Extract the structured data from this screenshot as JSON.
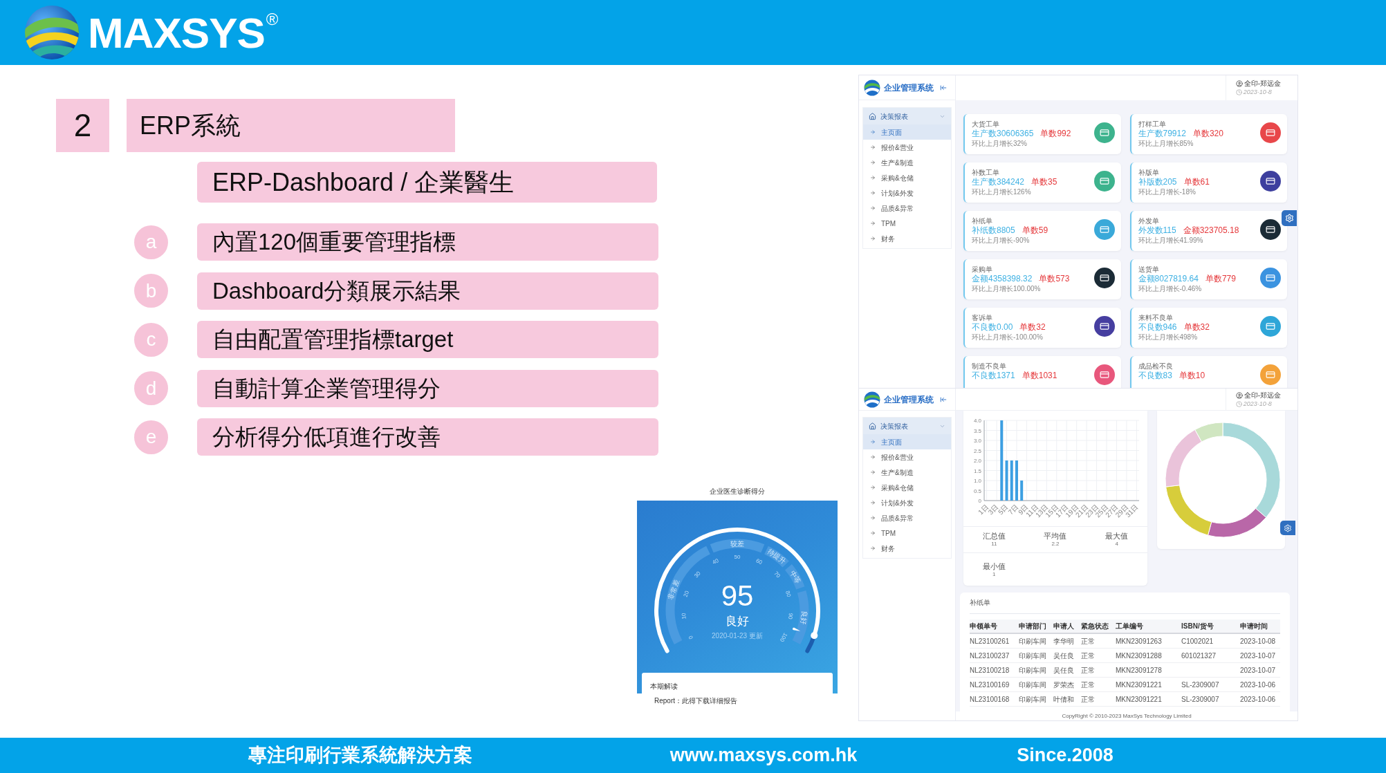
{
  "header": {
    "brand": "MAXSYS",
    "registered": "®"
  },
  "section": {
    "number": "2",
    "title": "ERP系統"
  },
  "subtitle": "ERP-Dashboard / 企業醫生",
  "points": [
    {
      "letter": "a",
      "text": "內置120個重要管理指標"
    },
    {
      "letter": "b",
      "text": "Dashboard分類展示結果"
    },
    {
      "letter": "c",
      "text": "自由配置管理指標target"
    },
    {
      "letter": "d",
      "text": "自動計算企業管理得分"
    },
    {
      "letter": "e",
      "text": "分析得分低項進行改善"
    }
  ],
  "gauge_screenshot": {
    "title": "企业医生诊断得分",
    "bands": [
      "非常差",
      "较差",
      "待提升",
      "中等",
      "良好"
    ],
    "ticks": [
      "0",
      "10",
      "20",
      "30",
      "40",
      "50",
      "60",
      "70",
      "80",
      "90",
      "100"
    ],
    "level": 0.95,
    "score": "95",
    "rating": "良好",
    "updated": "2020-01-23 更新",
    "report": {
      "heading": "本期解读",
      "text": "Report：此得下载详细报告"
    }
  },
  "cards_dashboard": {
    "app_name": "企业管理系统",
    "user": "全印-郑远金",
    "date": "2023-10-8",
    "menu": {
      "label": "决策报表",
      "expanded": true,
      "children": [
        {
          "label": "主页面",
          "selected": true
        },
        {
          "label": "报价&营业",
          "selected": false
        },
        {
          "label": "生产&制造",
          "selected": false
        },
        {
          "label": "采购&仓储",
          "selected": false
        },
        {
          "label": "计划&外发",
          "selected": false
        },
        {
          "label": "品质&异常",
          "selected": false
        },
        {
          "label": "TPM",
          "selected": false
        },
        {
          "label": "财务",
          "selected": false
        }
      ]
    },
    "cards": [
      {
        "title": "大货工单",
        "value": "生产数30606365",
        "count": "单数992",
        "change": "环比上月增长32%",
        "color": "#3db38d"
      },
      {
        "title": "打样工单",
        "value": "生产数79912",
        "count": "单数320",
        "change": "环比上月增长85%",
        "color": "#e8474a"
      },
      {
        "title": "补数工单",
        "value": "生产数384242",
        "count": "单数35",
        "change": "环比上月增长126%",
        "color": "#3db38d"
      },
      {
        "title": "补版单",
        "value": "补版数205",
        "count": "单数61",
        "change": "环比上月增长-18%",
        "color": "#3d3f9e"
      },
      {
        "title": "补纸单",
        "value": "补纸数8805",
        "count": "单数59",
        "change": "环比上月增长-90%",
        "color": "#3aa9d9"
      },
      {
        "title": "外发单",
        "value": "外发数115",
        "count": "金额323705.18",
        "change": "环比上月增长41.99%",
        "color": "#1b2b36"
      },
      {
        "title": "采购单",
        "value": "金额4358398.32",
        "count": "单数573",
        "change": "环比上月增长100.00%",
        "color": "#1b2b36"
      },
      {
        "title": "送货单",
        "value": "金额8027819.64",
        "count": "单数779",
        "change": "环比上月增长-0.46%",
        "color": "#3b93e0"
      },
      {
        "title": "客诉单",
        "value": "不良数0.00",
        "count": "单数32",
        "change": "环比上月增长-100.00%",
        "color": "#463ea0"
      },
      {
        "title": "来料不良单",
        "value": "不良数946",
        "count": "单数32",
        "change": "环比上月增长498%",
        "color": "#2ea6d8"
      },
      {
        "title": "制造不良单",
        "value": "不良数1371",
        "count": "单数1031",
        "color": "#e8577c"
      },
      {
        "title": "成品检不良",
        "value": "不良数83",
        "count": "单数10",
        "color": "#f3a23a"
      }
    ]
  },
  "charts_dashboard": {
    "app_name": "企业管理系统",
    "user": "全印-郑远金",
    "date": "2023-10-8",
    "menu": {
      "label": "决策报表",
      "expanded": true,
      "children": [
        {
          "label": "主页面",
          "selected": true
        },
        {
          "label": "报价&营业",
          "selected": false
        },
        {
          "label": "生产&制造",
          "selected": false
        },
        {
          "label": "采购&仓储",
          "selected": false
        },
        {
          "label": "计划&外发",
          "selected": false
        },
        {
          "label": "品质&异常",
          "selected": false
        },
        {
          "label": "TPM",
          "selected": false
        },
        {
          "label": "财务",
          "selected": false
        }
      ]
    },
    "chart_data": {
      "type": "bar",
      "grid": true,
      "x": [
        1,
        2,
        3,
        4,
        5,
        6,
        7,
        8,
        9,
        10,
        11,
        12,
        13,
        14,
        15,
        16,
        17,
        18,
        19,
        20,
        21,
        22,
        23,
        24,
        25,
        26,
        27,
        28,
        29,
        30,
        31
      ],
      "values": [
        0,
        0,
        0,
        4,
        2,
        2,
        2,
        1,
        0,
        0,
        0,
        0,
        0,
        0,
        0,
        0,
        0,
        0,
        0,
        0,
        0,
        0,
        0,
        0,
        0,
        0,
        0,
        0,
        0,
        0,
        0
      ],
      "xlim": [
        0.5,
        31.5
      ],
      "ylim": [
        0,
        4
      ],
      "xticks": [
        {
          "value": 1,
          "label": "1日"
        },
        {
          "value": 3,
          "label": "3日"
        },
        {
          "value": 5,
          "label": "5日"
        },
        {
          "value": 7,
          "label": "7日"
        },
        {
          "value": 9,
          "label": "9日"
        },
        {
          "value": 11,
          "label": "11日"
        },
        {
          "value": 13,
          "label": "13日"
        },
        {
          "value": 15,
          "label": "15日"
        },
        {
          "value": 17,
          "label": "17日"
        },
        {
          "value": 19,
          "label": "19日"
        },
        {
          "value": 21,
          "label": "21日"
        },
        {
          "value": 23,
          "label": "23日"
        },
        {
          "value": 25,
          "label": "25日"
        },
        {
          "value": 27,
          "label": "27日"
        },
        {
          "value": 29,
          "label": "29日"
        },
        {
          "value": 31,
          "label": "31日"
        }
      ],
      "yticks": [
        0,
        0.5,
        {
          "value": 1,
          "label": "1.0"
        },
        1.5,
        {
          "value": 2,
          "label": "2.0"
        },
        2.5,
        {
          "value": 3,
          "label": "3.0"
        },
        3.5,
        {
          "value": 4,
          "label": "4.0"
        }
      ]
    },
    "stats": [
      {
        "label": "汇总值",
        "value": "11"
      },
      {
        "label": "平均值",
        "value": "2.2"
      },
      {
        "label": "最大值",
        "value": "4"
      },
      {
        "label": "最小值",
        "value": "1"
      }
    ],
    "table": {
      "title": "补纸单",
      "columns": [
        "申领单号",
        "申请部门",
        "申请人",
        "紧急状态",
        "工单编号",
        "ISBN/货号",
        "申请时间"
      ],
      "rows": [
        [
          "NL23100261",
          "印刷车间",
          "李华明",
          "正常",
          "MKN23091263",
          "C1002021",
          "2023-10-08"
        ],
        [
          "NL23100237",
          "印刷车间",
          "吴任良",
          "正常",
          "MKN23091288",
          "601021327",
          "2023-10-07"
        ],
        [
          "NL23100218",
          "印刷车间",
          "吴任良",
          "正常",
          "MKN23091278",
          null,
          "2023-10-07"
        ],
        [
          "NL23100169",
          "印刷车间",
          "罗荣杰",
          "正常",
          "MKN23091221",
          "SL-2309007",
          "2023-10-06"
        ],
        [
          "NL23100168",
          "印刷车间",
          "叶倩和",
          "正常",
          "MKN23091221",
          "SL-2309007",
          "2023-10-06"
        ]
      ]
    },
    "copyright": "CopyRight © 2010-2023 MaxSys Technology Limited"
  },
  "footer": [
    "專注印刷行業系統解決方案",
    "www.maxsys.com.hk",
    "Since.2008"
  ]
}
